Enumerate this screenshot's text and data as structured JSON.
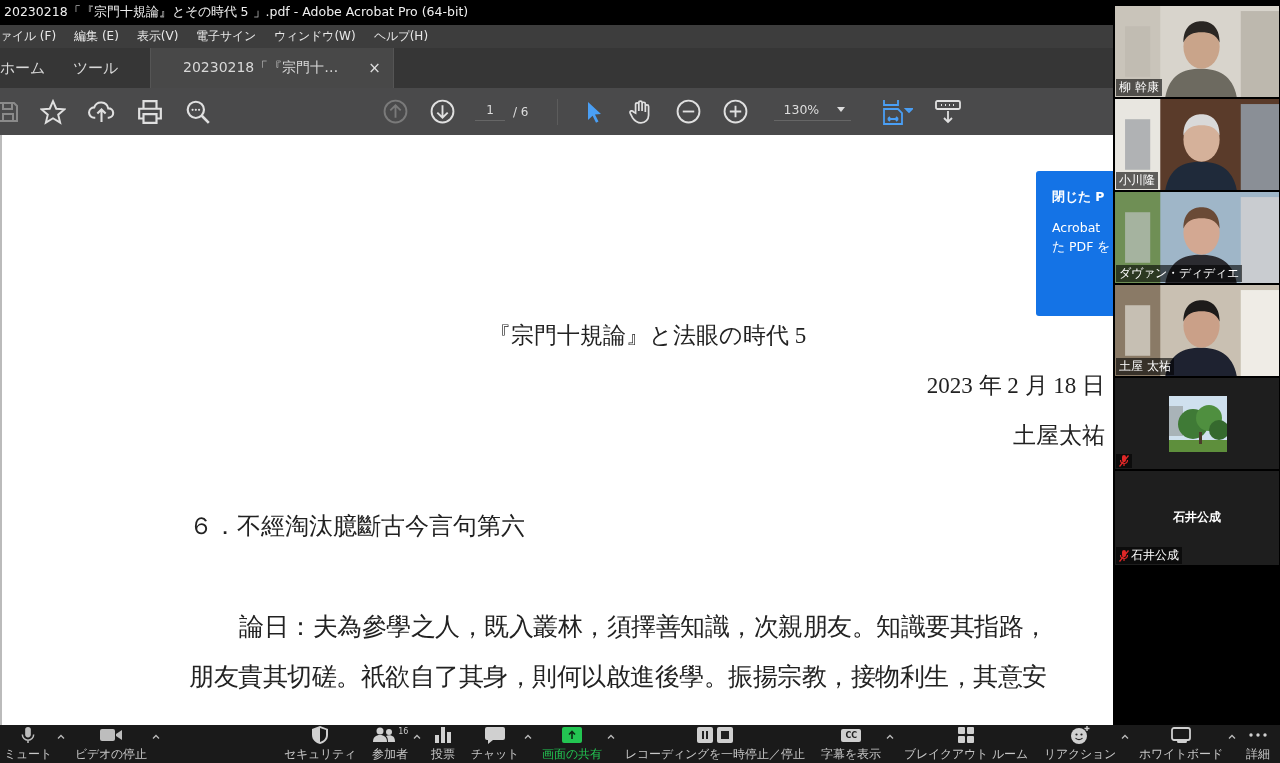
{
  "window": {
    "title": "20230218「『宗門十規論』とその時代 5 」.pdf - Adobe Acrobat Pro (64-bit)"
  },
  "menu": [
    "ァイル (F)",
    "編集 (E)",
    "表示(V)",
    "電子サイン",
    "ウィンドウ(W)",
    "ヘルプ(H)"
  ],
  "tabs": [
    {
      "label": "ホーム",
      "selected": false
    },
    {
      "label": "ツール",
      "selected": false
    },
    {
      "label": "20230218「『宗門十…",
      "selected": true,
      "close": "×"
    }
  ],
  "toolbar": {
    "prev_disabled": true,
    "page": "1",
    "page_total": "/ 6",
    "zoom": "130%"
  },
  "popup": {
    "title": "閉じた P",
    "lines": [
      "Acrobat",
      "た PDF を"
    ]
  },
  "document": {
    "title": "『宗門十規論』と法眼の時代 5",
    "date": "2023 年 2 月 18 日",
    "author": "土屋太祐",
    "heading": "６．不經淘汰臆斷古今言句第六",
    "paragraph": [
      "論日：夫為參學之人，既入叢林，須擇善知識，次親朋友。知識要其指路，",
      "朋友貴其切磋。祇欲自了其身，則何以啟進後學。振揚宗教，接物利生，其意安"
    ]
  },
  "participants": [
    {
      "kind": "video",
      "name": "柳 幹康",
      "muted": false
    },
    {
      "kind": "video",
      "name": "小川隆",
      "muted": false
    },
    {
      "kind": "video",
      "name": "ダヴァン・ディディエ",
      "muted": false
    },
    {
      "kind": "video",
      "name": "土屋 太祐",
      "muted": false
    },
    {
      "kind": "thumbnail",
      "muted": true
    },
    {
      "kind": "avatar",
      "display_name": "石井公成",
      "name": "石井公成",
      "muted": true
    }
  ],
  "meeting_controls": [
    {
      "kind": "mic",
      "label": "ミュート",
      "caret": true,
      "highlighted": false
    },
    {
      "kind": "video",
      "label": "ビデオの停止",
      "caret": true,
      "highlighted": false
    },
    {
      "kind": "security",
      "label": "セキュリティ",
      "caret": false,
      "highlighted": false
    },
    {
      "kind": "participants",
      "label": "参加者",
      "count": "16",
      "caret": true,
      "highlighted": false
    },
    {
      "kind": "poll",
      "label": "投票",
      "caret": false,
      "highlighted": false
    },
    {
      "kind": "chat",
      "label": "チャット",
      "caret": true,
      "highlighted": false
    },
    {
      "kind": "share",
      "label": "画面の共有",
      "caret": true,
      "highlighted": true
    },
    {
      "kind": "record",
      "label": "レコーディングを一時停止／停止",
      "caret": false,
      "highlighted": false
    },
    {
      "kind": "captions",
      "label": "字幕を表示",
      "icon_text": "CC",
      "caret": true,
      "highlighted": false
    },
    {
      "kind": "breakout",
      "label": "ブレイクアウト ルーム",
      "caret": false,
      "highlighted": false
    },
    {
      "kind": "reactions",
      "label": "リアクション",
      "caret": true,
      "highlighted": false
    },
    {
      "kind": "whiteboard",
      "label": "ホワイトボード",
      "caret": true,
      "highlighted": false
    },
    {
      "kind": "more",
      "label": "詳細",
      "caret": false,
      "highlighted": false
    }
  ]
}
